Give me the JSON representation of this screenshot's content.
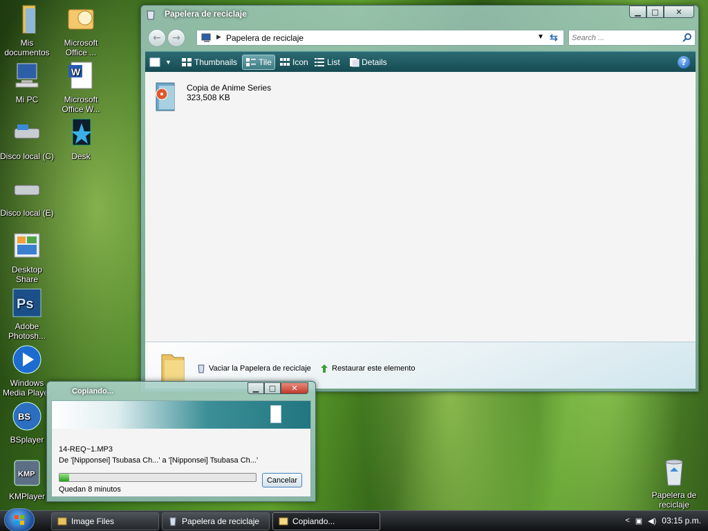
{
  "desktop": {
    "icons": [
      {
        "label": "Mis documentos"
      },
      {
        "label": "Microsoft Office ..."
      },
      {
        "label": "Mi PC"
      },
      {
        "label": "Microsoft Office W..."
      },
      {
        "label": "Disco local (C)"
      },
      {
        "label": "Desk"
      },
      {
        "label": "Disco local (E)"
      },
      {
        "label": "Desktop Share"
      },
      {
        "label": "Adobe Photosh..."
      },
      {
        "label": "Windows Media Player"
      },
      {
        "label": "BSplayer"
      },
      {
        "label": "KMPlayer"
      },
      {
        "label": "Papelera de reciclaje"
      }
    ]
  },
  "explorer": {
    "title": "Papelera de reciclaje",
    "address": "Papelera de reciclaje",
    "search_placeholder": "Search ...",
    "toolbar": {
      "thumbnails": "Thumbnails",
      "tile": "Tile",
      "icon": "Icon",
      "list": "List",
      "details": "Details",
      "help": "?"
    },
    "items": [
      {
        "name": "Copia de Anime Series",
        "size": "323,508 KB"
      }
    ],
    "details_pane": {
      "empty_bin": "Vaciar la Papelera de reciclaje",
      "restore": "Restaurar este elemento"
    }
  },
  "copy_dialog": {
    "title": "Copiando...",
    "file": "14-REQ~1.MP3",
    "from_to": "De '[Nipponsei] Tsubasa Ch...' a '[Nipponsei] Tsubasa Ch...'",
    "progress": 0.05,
    "remaining": "Quedan 8 minutos",
    "cancel": "Cancelar"
  },
  "taskbar": {
    "tasks": [
      {
        "label": "Image Files"
      },
      {
        "label": "Papelera de reciclaje"
      },
      {
        "label": "Copiando..."
      }
    ],
    "clock": "03:15 p.m."
  }
}
